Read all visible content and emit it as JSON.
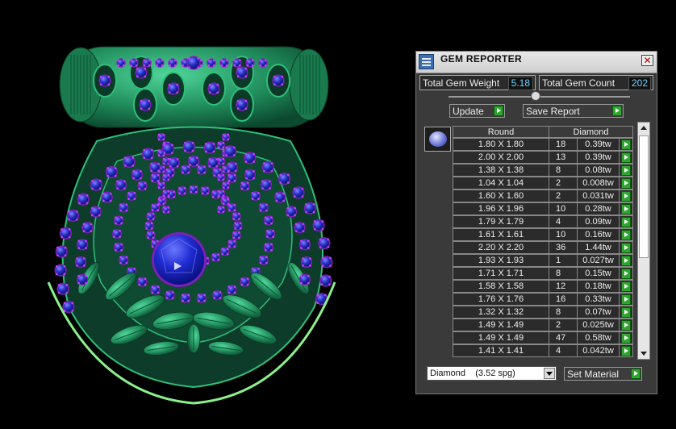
{
  "viewport": {
    "description_icon": "pendant-3d-render",
    "play_icon": "play-icon"
  },
  "panel": {
    "title": "GEM REPORTER",
    "close_label": "✕",
    "total_weight_label": "Total Gem Weight",
    "total_weight_value": "5.18",
    "total_count_label": "Total Gem Count",
    "total_count_value": "202",
    "update_label": "Update",
    "save_label": "Save Report",
    "table": {
      "headers": [
        "Round",
        "Diamond"
      ],
      "rows": [
        {
          "size": "1.80 X 1.80",
          "count": "18",
          "weight": "0.39tw"
        },
        {
          "size": "2.00 X 2.00",
          "count": "13",
          "weight": "0.39tw"
        },
        {
          "size": "1.38 X 1.38",
          "count": "8",
          "weight": "0.08tw"
        },
        {
          "size": "1.04 X 1.04",
          "count": "2",
          "weight": "0.008tw"
        },
        {
          "size": "1.60 X 1.60",
          "count": "2",
          "weight": "0.031tw"
        },
        {
          "size": "1.96 X 1.96",
          "count": "10",
          "weight": "0.28tw"
        },
        {
          "size": "1.79 X 1.79",
          "count": "4",
          "weight": "0.09tw"
        },
        {
          "size": "1.61 X 1.61",
          "count": "10",
          "weight": "0.16tw"
        },
        {
          "size": "2.20 X 2.20",
          "count": "36",
          "weight": "1.44tw"
        },
        {
          "size": "1.93 X 1.93",
          "count": "1",
          "weight": "0.027tw"
        },
        {
          "size": "1.71 X 1.71",
          "count": "8",
          "weight": "0.15tw"
        },
        {
          "size": "1.58 X 1.58",
          "count": "12",
          "weight": "0.18tw"
        },
        {
          "size": "1.76 X 1.76",
          "count": "16",
          "weight": "0.33tw"
        },
        {
          "size": "1.32 X 1.32",
          "count": "8",
          "weight": "0.07tw"
        },
        {
          "size": "1.49 X 1.49",
          "count": "2",
          "weight": "0.025tw"
        },
        {
          "size": "1.49 X 1.49",
          "count": "47",
          "weight": "0.58tw"
        },
        {
          "size": "1.41 X 1.41",
          "count": "4",
          "weight": "0.042tw"
        }
      ]
    },
    "material_select": "Diamond    (3.52 spg)",
    "set_material_label": "Set Material"
  },
  "colors": {
    "accent_green": "#2ea52e",
    "value_blue": "#6fd3ff",
    "metal_green": "#1f8a5a",
    "gem_blue": "#2830c8",
    "prong_purple": "#9a2ad0"
  }
}
